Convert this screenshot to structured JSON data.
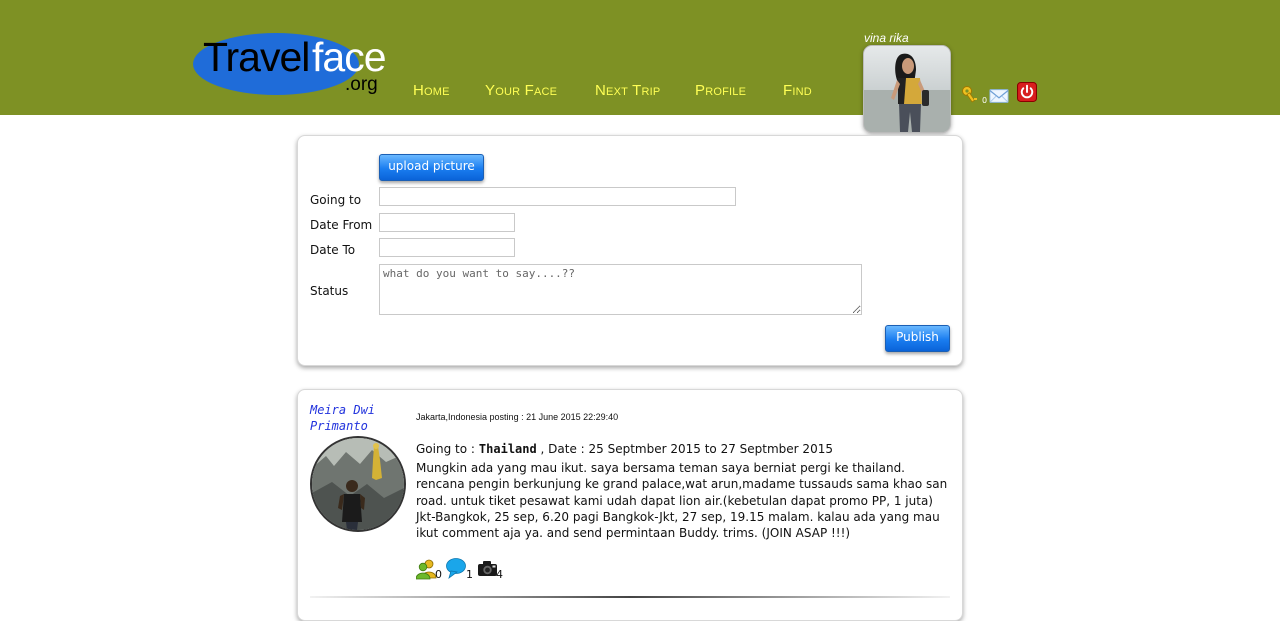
{
  "brand": {
    "logo_travel": "Travel",
    "logo_face": "face",
    "logo_org": ".org"
  },
  "nav": {
    "items": [
      {
        "label": "Home"
      },
      {
        "label": "Your Face"
      },
      {
        "label": "Next Trip"
      },
      {
        "label": "Profile"
      },
      {
        "label": "Find"
      }
    ]
  },
  "user": {
    "name": "vina rika",
    "key_count": "0",
    "icons": [
      "key-icon",
      "mail-icon",
      "power-icon"
    ]
  },
  "form": {
    "upload_label": "upload picture",
    "going_to_label": "Going to",
    "going_to_value": "",
    "date_from_label": "Date From",
    "date_from_value": "",
    "date_to_label": "Date To",
    "date_to_value": "",
    "status_label": "Status",
    "status_placeholder": "what do you want to say....??",
    "publish_label": "Publish"
  },
  "post": {
    "author": "Meira Dwi Primanto",
    "meta": "Jakarta,Indonesia posting : 21 June 2015 22:29:40",
    "going_to_prefix": "Going to :",
    "destination": "Thailand",
    "date_text": ", Date : 25 Septmber 2015 to 27 Septmber 2015",
    "body": "Mungkin ada yang mau ikut. saya bersama teman saya berniat pergi ke thailand. rencana pengin berkunjung ke grand palace,wat arun,madame tussauds sama khao san road. untuk tiket pesawat kami udah dapat lion air.(kebetulan dapat promo PP, 1 juta) Jkt-Bangkok, 25 sep, 6.20 pagi Bangkok-Jkt, 27 sep, 19.15 malam. kalau ada yang mau ikut comment aja ya. and send permintaan Buddy. trims. (JOIN ASAP !!!)",
    "stats": {
      "buddies": "0",
      "comments": "1",
      "photos": "4"
    }
  },
  "colors": {
    "header_bg": "#7e9124",
    "nav_text": "#ffff55",
    "button_blue": "#1a7df0",
    "author_name": "#2233dd"
  }
}
